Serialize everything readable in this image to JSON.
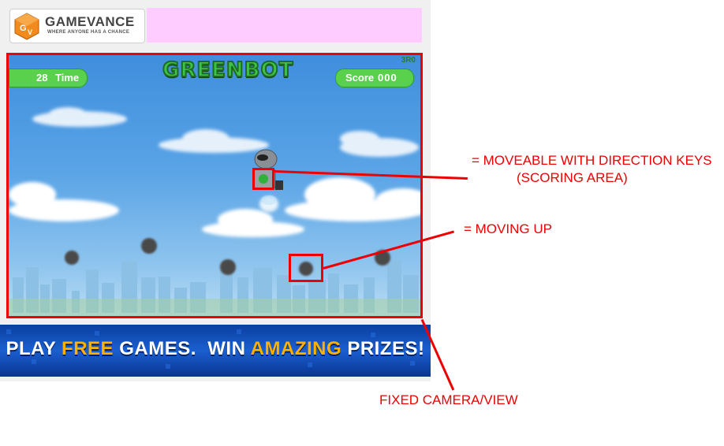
{
  "site": {
    "logo_name": "GAMEVANCE",
    "logo_tagline": "WHERE ANYONE HAS A CHANCE"
  },
  "game": {
    "title": "GREENBOT",
    "version": "3R0",
    "time_value": "28",
    "time_label": "Time",
    "score_label": "Score",
    "score_value": "000"
  },
  "banner": {
    "part1": "PLAY ",
    "part2": "FREE",
    "part3": " GAMES.  WIN ",
    "part4": "AMAZING",
    "part5": " PRIZES!"
  },
  "annotations": {
    "player": "= MOVEABLE WITH DIRECTION KEYS",
    "player_sub": "(SCORING AREA)",
    "rock": "= MOVING UP",
    "camera": "FIXED CAMERA/VIEW"
  },
  "colors": {
    "annotation": "#ee0000",
    "hud_pill": "#5ad14d",
    "title_green": "#3cc24a",
    "ad_slot": "#ffccff",
    "banner_highlight": "#ffb000"
  }
}
